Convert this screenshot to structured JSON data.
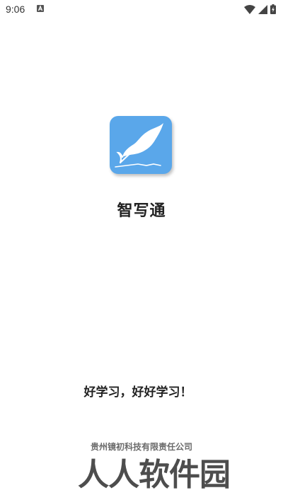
{
  "status_bar": {
    "time": "9:06",
    "notification_icon": "a-box-icon",
    "icons": [
      "wifi-icon",
      "signal-icon",
      "battery-charging-icon"
    ]
  },
  "app": {
    "name": "智写通",
    "logo_icon": "feather-quill-icon",
    "logo_color": "#5aa7ea",
    "slogan": "好学习，好好学习！",
    "company": "贵州镜初科技有限责任公司"
  },
  "watermark": {
    "text": "人人软件园"
  }
}
